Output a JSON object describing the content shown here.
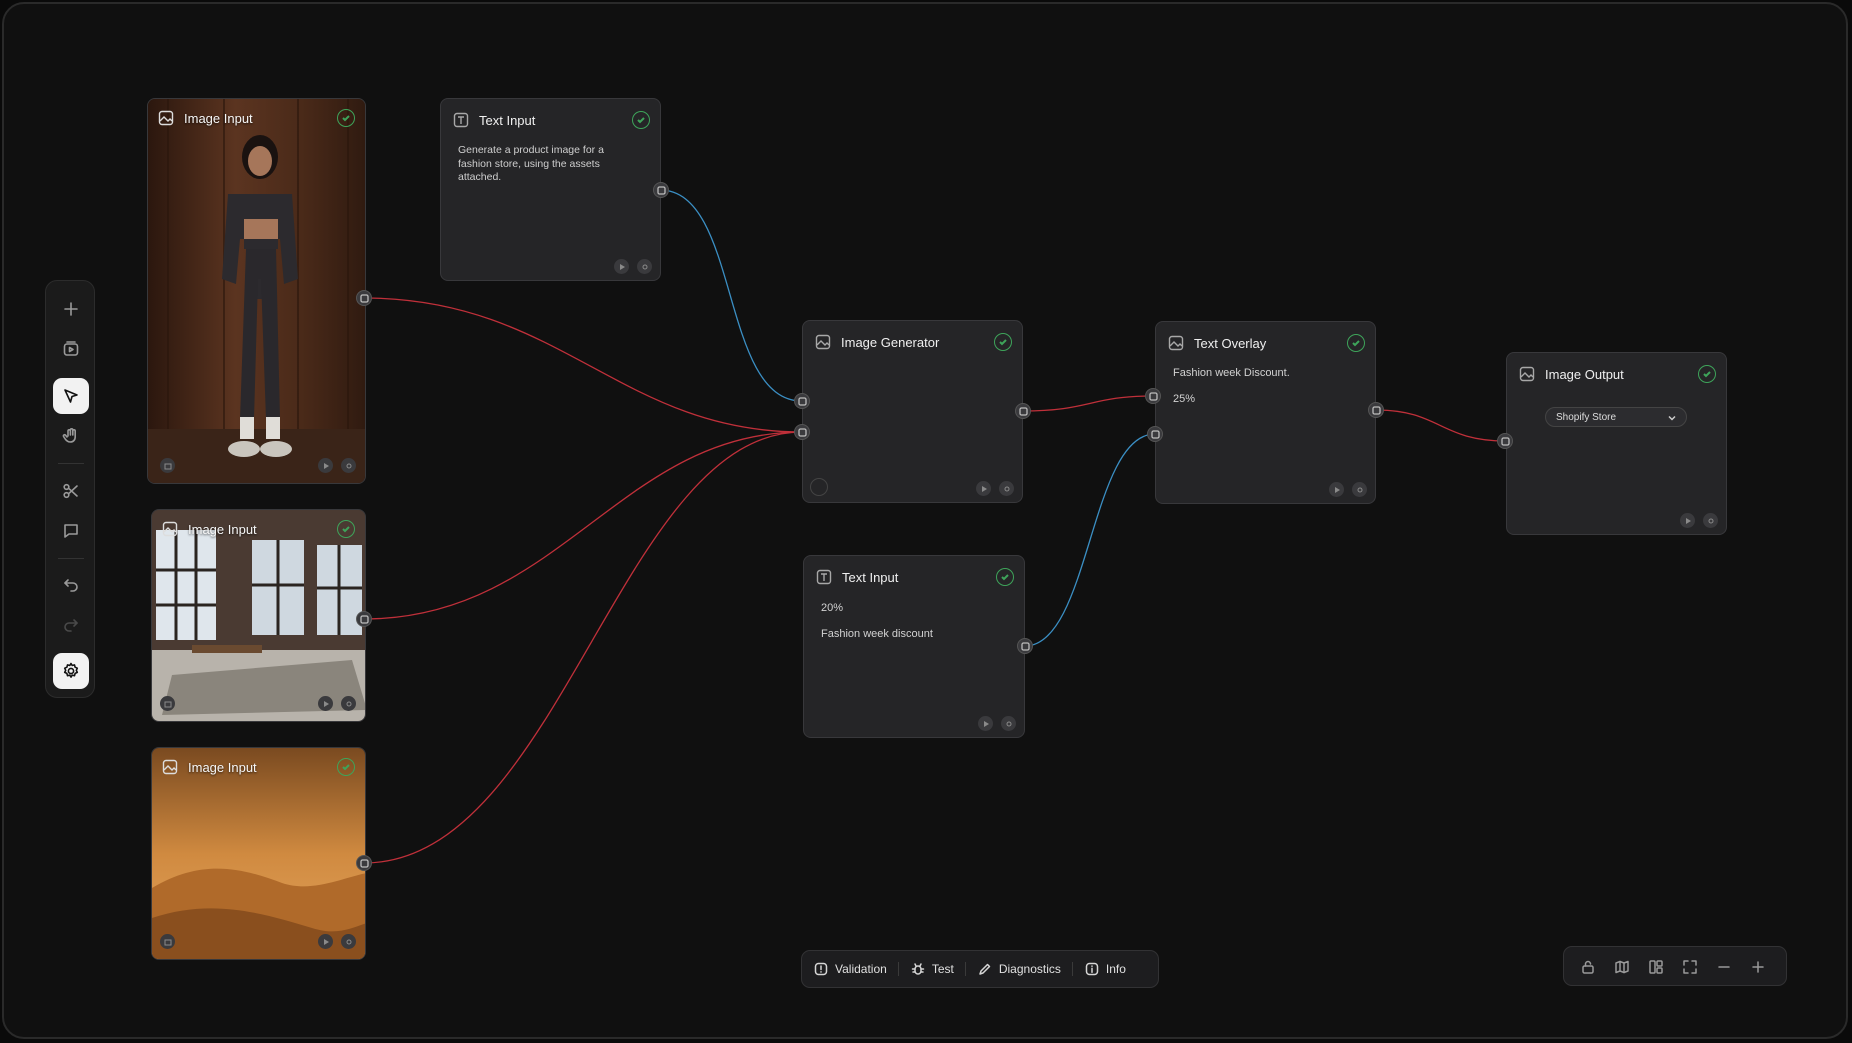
{
  "toolbar": {
    "tools": [
      {
        "name": "add-tool",
        "icon": "plus-icon"
      },
      {
        "name": "media-tool",
        "icon": "media-icon"
      },
      {
        "name": "select-tool",
        "icon": "pointer-icon",
        "active": true
      },
      {
        "name": "pan-tool",
        "icon": "hand-icon"
      },
      {
        "name": "cut-tool",
        "icon": "scissors-icon"
      },
      {
        "name": "comment-tool",
        "icon": "comment-icon"
      },
      {
        "name": "undo-tool",
        "icon": "undo-icon"
      },
      {
        "name": "redo-tool",
        "icon": "redo-icon",
        "disabled": true
      },
      {
        "name": "settings-tool",
        "icon": "gear-icon",
        "active": true
      }
    ]
  },
  "nodes": {
    "image_input_1": {
      "title": "Image Input",
      "status": "complete"
    },
    "image_input_2": {
      "title": "Image Input",
      "status": "complete"
    },
    "image_input_3": {
      "title": "Image Input",
      "status": "complete"
    },
    "text_input_1": {
      "title": "Text Input",
      "status": "complete",
      "text": "Generate a product image for a fashion store, using the assets attached."
    },
    "image_generator": {
      "title": "Image Generator",
      "status": "complete"
    },
    "text_input_2": {
      "title": "Text Input",
      "status": "complete",
      "line1": "20%",
      "line2": "Fashion week discount"
    },
    "text_overlay": {
      "title": "Text Overlay",
      "status": "complete",
      "line1": "Fashion week Discount.",
      "line2": "25%"
    },
    "image_output": {
      "title": "Image Output",
      "status": "complete",
      "destination": "Shopify Store"
    }
  },
  "bottom_bar": {
    "validation": "Validation",
    "test": "Test",
    "diagnostics": "Diagnostics",
    "info": "Info"
  },
  "view_controls": [
    "lock-icon",
    "map-icon",
    "layout-icon",
    "fullscreen-icon",
    "zoom-out-icon",
    "zoom-in-icon"
  ],
  "colors": {
    "image_wire": "#c0303a",
    "text_wire": "#3b8fc4",
    "status_ok": "#3ea45a",
    "canvas": "#101010",
    "node_bg": "#252527"
  }
}
